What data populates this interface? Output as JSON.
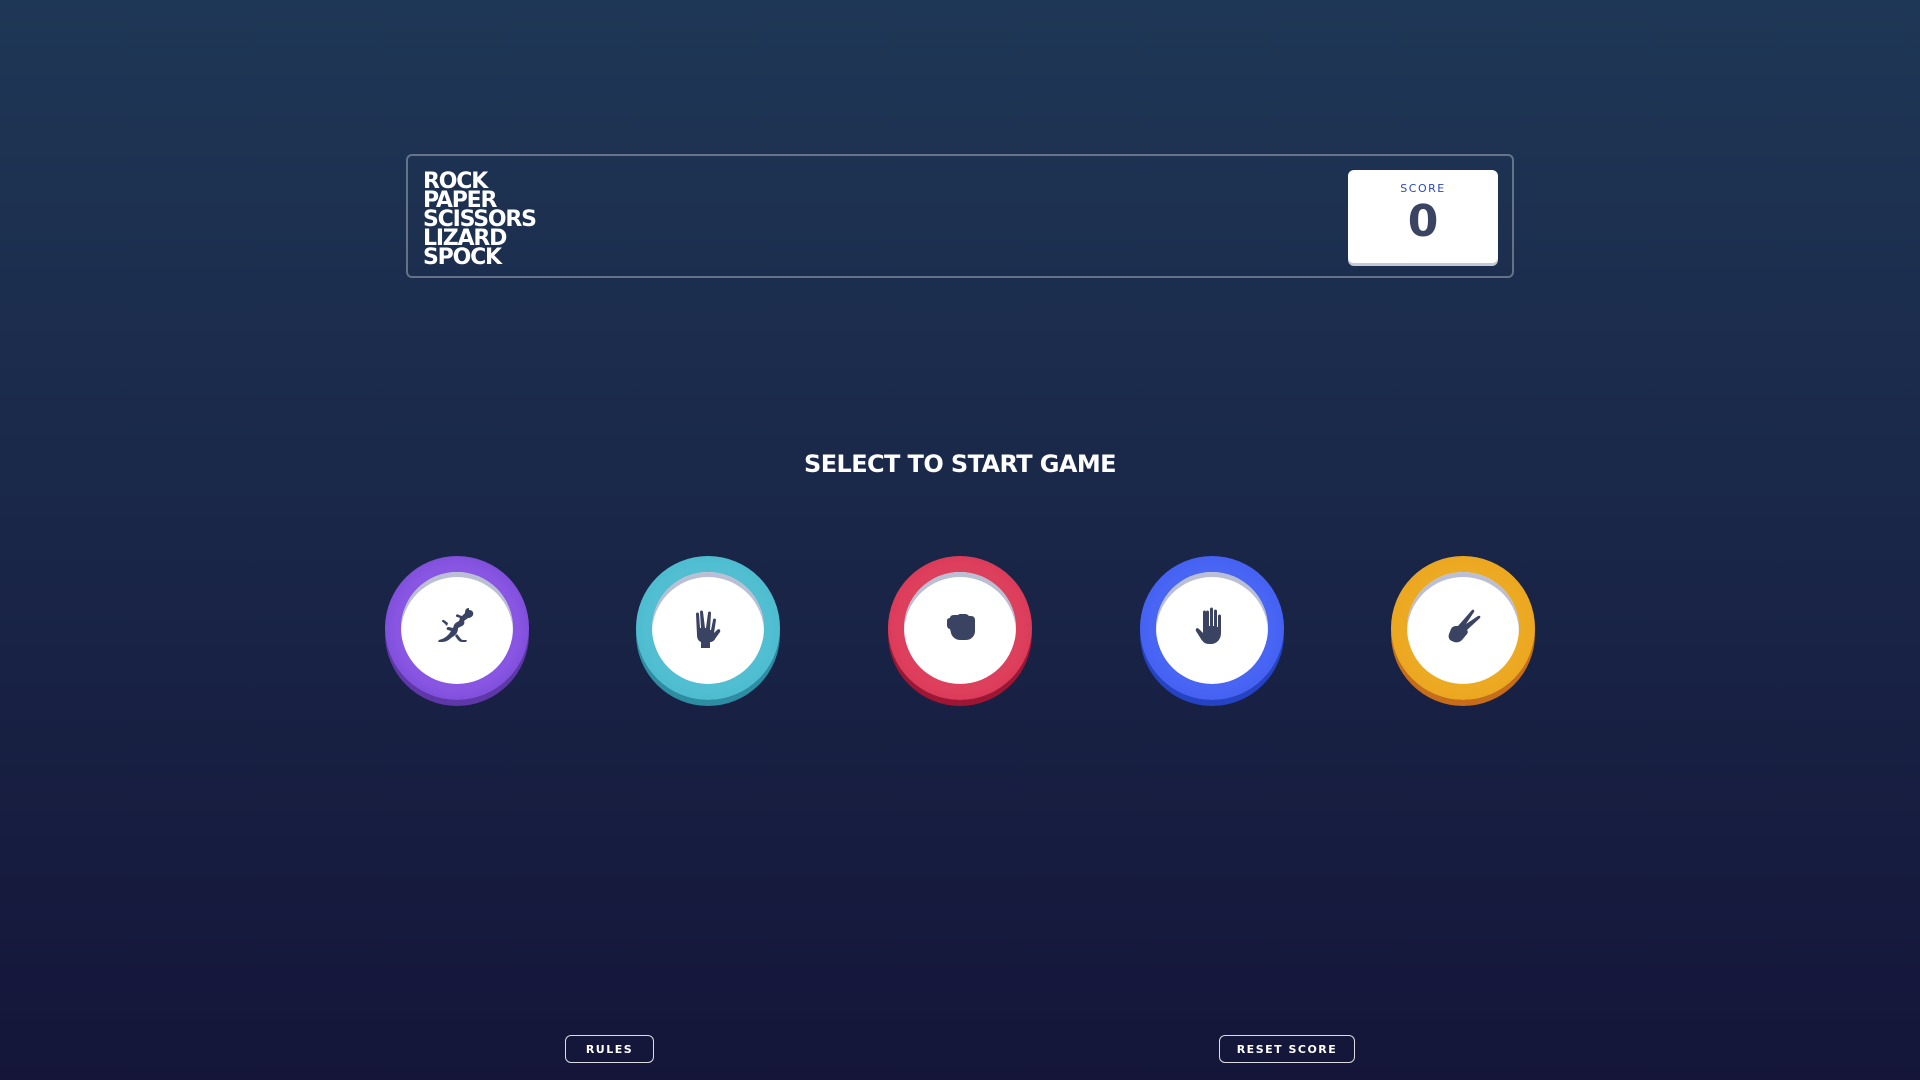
{
  "header": {
    "logo_lines": [
      "ROCK",
      "PAPER",
      "SCISSORS",
      "LIZARD",
      "SPOCK"
    ],
    "score": {
      "label": "SCORE",
      "value": "0"
    }
  },
  "main": {
    "prompt": "SELECT TO START GAME",
    "choices": [
      {
        "id": "lizard",
        "icon": "lizard-icon",
        "ring_color": "#7a44dd"
      },
      {
        "id": "spock",
        "icon": "spock-icon",
        "ring_color": "#40b9ce"
      },
      {
        "id": "rock",
        "icon": "rock-icon",
        "ring_color": "#db2e4d"
      },
      {
        "id": "paper",
        "icon": "paper-icon",
        "ring_color": "#3a57ef"
      },
      {
        "id": "scissors",
        "icon": "scissors-icon",
        "ring_color": "#e9a11b"
      }
    ],
    "icon_color": "#3b4363"
  },
  "footer": {
    "rules_label": "RULES",
    "reset_label": "RESET SCORE"
  },
  "colors": {
    "background_top": "#1f3756",
    "background_bottom": "#141539",
    "score_label": "#2a45c2",
    "score_value": "#3b4363"
  }
}
